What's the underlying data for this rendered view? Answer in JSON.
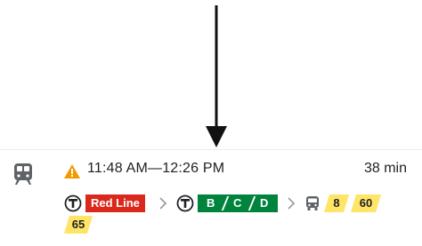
{
  "icons": {
    "arrow": "down-arrow-icon",
    "mode": "train-icon",
    "alert": "warning-icon",
    "transit": "mbta-t-icon",
    "separator": "chevron-right-icon",
    "bus": "bus-icon"
  },
  "trip": {
    "time_range": "11:48 AM—12:26 PM",
    "duration": "38 min"
  },
  "legs": {
    "red": {
      "label": "Red Line",
      "color": "#da291c"
    },
    "green": {
      "branches": [
        "B",
        "C",
        "D"
      ],
      "color": "#00843d"
    },
    "bus": {
      "routes": [
        "8",
        "60",
        "65"
      ],
      "color": "#ffe566"
    }
  },
  "colors": {
    "alert": "#f29900",
    "icon_gray": "#5f6368",
    "text": "#202124"
  }
}
